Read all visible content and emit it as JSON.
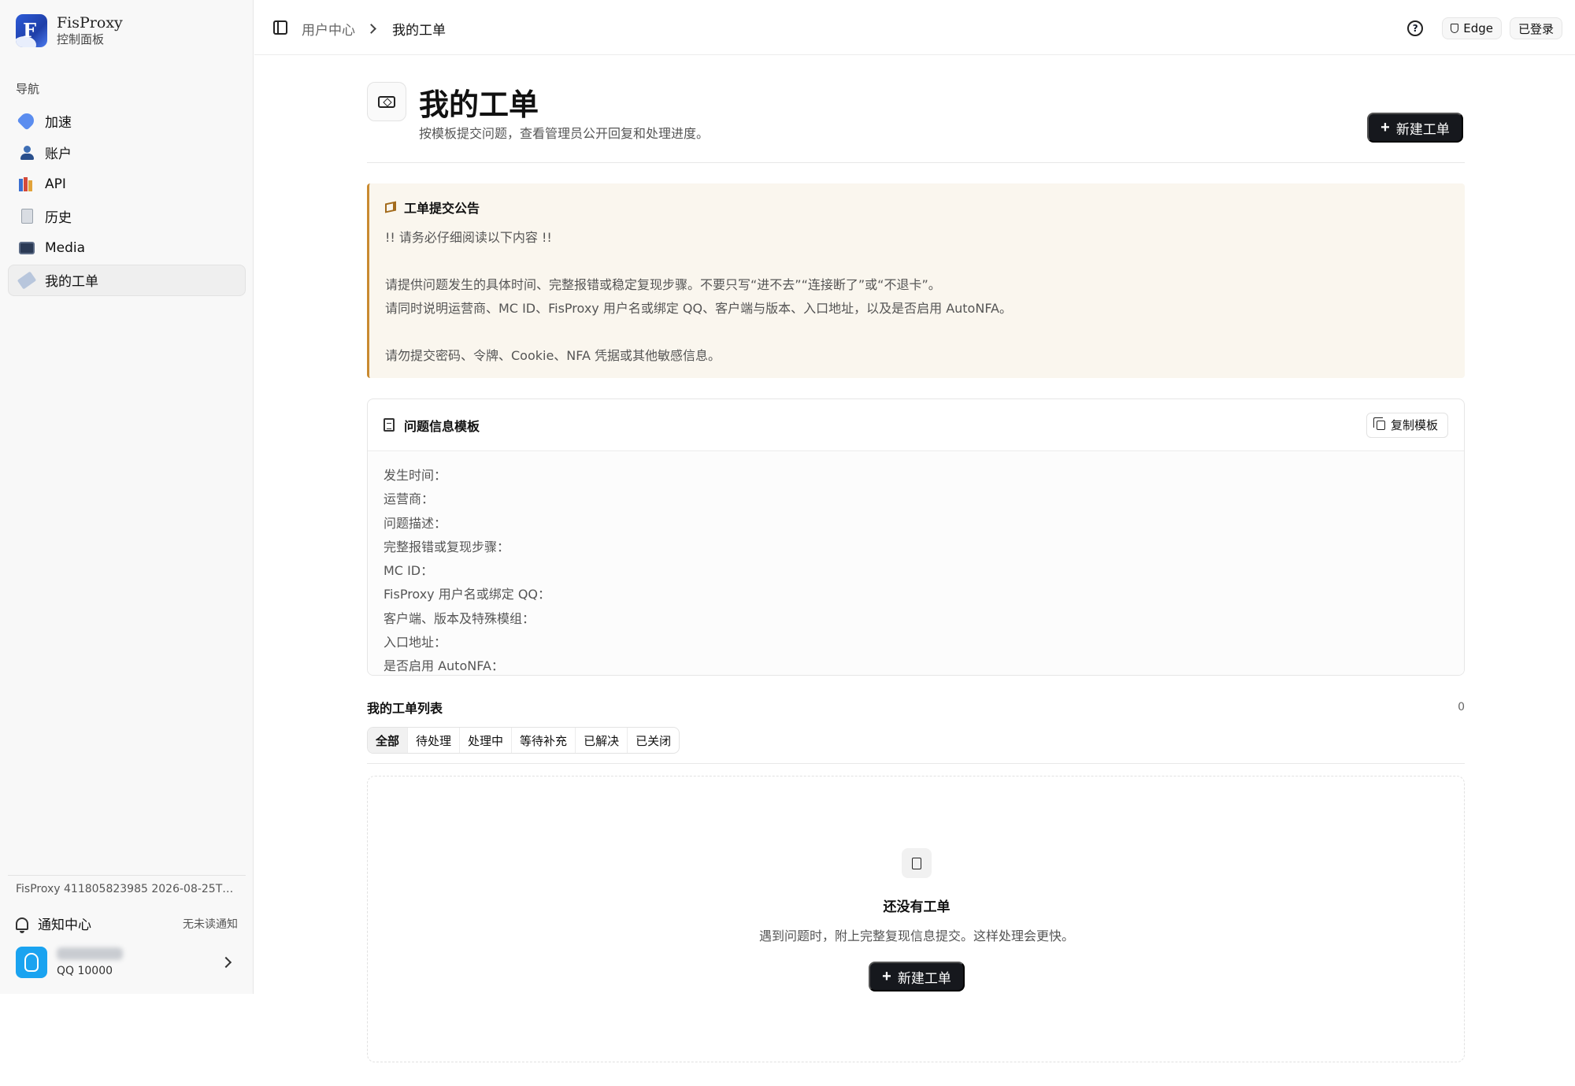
{
  "brand": {
    "name": "FisProxy",
    "subtitle": "控制面板"
  },
  "sidebar": {
    "section_label": "导航",
    "items": [
      {
        "label": "加速",
        "icon": "rocket-icon"
      },
      {
        "label": "账户",
        "icon": "user-icon"
      },
      {
        "label": "API",
        "icon": "books-icon"
      },
      {
        "label": "历史",
        "icon": "ledger-icon"
      },
      {
        "label": "Media",
        "icon": "tv-icon"
      },
      {
        "label": "我的工单",
        "icon": "ticket-icon",
        "active": true
      }
    ],
    "version": "FisProxy 411805823985 2026-08-25T1…",
    "notifications": {
      "label": "通知中心",
      "status": "无未读通知"
    },
    "user": {
      "qq": "QQ 10000"
    }
  },
  "topbar": {
    "breadcrumb": [
      "用户中心",
      "我的工单"
    ],
    "browser_label": "Edge",
    "login_status": "已登录"
  },
  "page": {
    "title": "我的工单",
    "subtitle": "按模板提交问题，查看管理员公开回复和处理进度。",
    "new_ticket_label": "新建工单"
  },
  "notice": {
    "title": "工单提交公告",
    "body": "!! 请务必仔细阅读以下内容 !!\n\n请提供问题发生的具体时间、完整报错或稳定复现步骤。不要只写“进不去”“连接断了”或“不退卡”。\n请同时说明运营商、MC ID、FisProxy 用户名或绑定 QQ、客户端与版本、入口地址，以及是否启用 AutoNFA。\n\n请勿提交密码、令牌、Cookie、NFA 凭据或其他敏感信息。"
  },
  "template": {
    "title": "问题信息模板",
    "copy_label": "复制模板",
    "content": "发生时间：\n运营商：\n问题描述：\n完整报错或复现步骤：\nMC ID：\nFisProxy 用户名或绑定 QQ：\n客户端、版本及特殊模组：\n入口地址：\n是否启用 AutoNFA："
  },
  "ticket_list": {
    "title": "我的工单列表",
    "count": "0",
    "tabs": [
      "全部",
      "待处理",
      "处理中",
      "等待补充",
      "已解决",
      "已关闭"
    ],
    "active_tab": "全部",
    "empty_title": "还没有工单",
    "empty_subtitle": "遇到问题时，附上完整复现信息提交。这样处理会更快。",
    "empty_button": "新建工单"
  },
  "colors": {
    "accent_dark": "#16181d",
    "notice_border": "#c98a30",
    "notice_bg": "#faf6ee",
    "qq_blue": "#1aa3f0"
  }
}
